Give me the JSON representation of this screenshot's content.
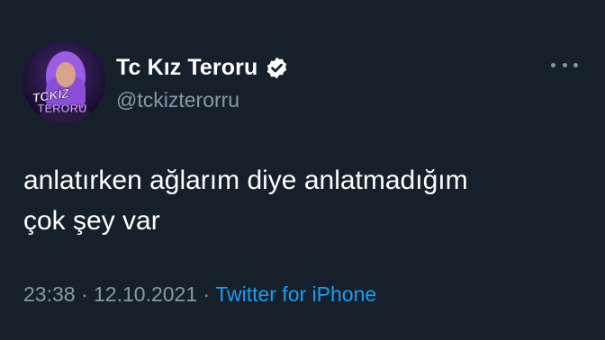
{
  "tweet": {
    "display_name": "Tc Kız Teroru",
    "handle": "@tckizterorru",
    "verified": true,
    "avatar_logo_text": [
      "TCKIZ",
      "TERORU"
    ],
    "more_icon": "more-horizontal-icon",
    "text": "anlatırken ağlarım diye anlatmadığım\nçok şey var",
    "time": "23:38",
    "separator": "·",
    "date": "12.10.2021",
    "source": "Twitter for iPhone"
  },
  "colors": {
    "background": "#15202b",
    "primary_text": "#ffffff",
    "secondary_text": "#8899a6",
    "link": "#1d9bf0"
  }
}
